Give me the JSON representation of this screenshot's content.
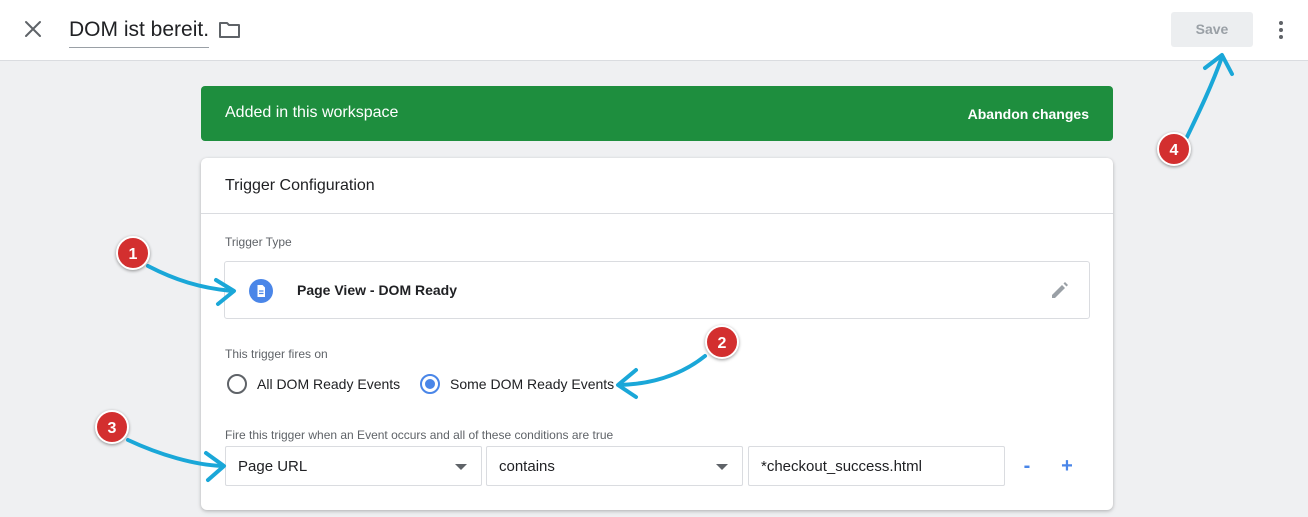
{
  "header": {
    "title": "DOM ist bereit.",
    "save_label": "Save"
  },
  "banner": {
    "text": "Added in this workspace",
    "action_label": "Abandon changes",
    "color": "#1e8e3e"
  },
  "card": {
    "title": "Trigger Configuration",
    "trigger_type_label": "Trigger Type",
    "trigger_type_name": "Page View - DOM Ready",
    "trigger_type_icon": "document-icon",
    "fires_on_label": "This trigger fires on",
    "fires_on_options": [
      {
        "label": "All DOM Ready Events",
        "selected": false
      },
      {
        "label": "Some DOM Ready Events",
        "selected": true
      }
    ],
    "condition_label": "Fire this trigger when an Event occurs and all of these conditions are true",
    "condition": {
      "variable": "Page URL",
      "operator": "contains",
      "value": "*checkout_success.html"
    },
    "remove_label": "-",
    "add_label": "+"
  },
  "annotations": [
    "1",
    "2",
    "3",
    "4"
  ],
  "accent_color": "#4a86e8",
  "annotation_color": "#d32f2f",
  "arrow_color": "#1aa7d8"
}
